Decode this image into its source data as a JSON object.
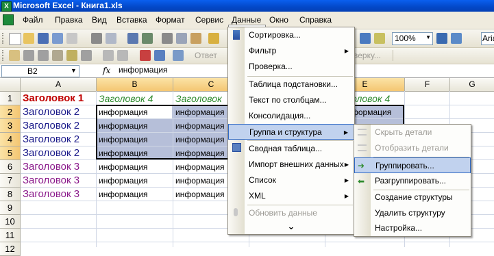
{
  "window": {
    "title": "Microsoft Excel - Книга1.xls"
  },
  "menubar": {
    "items": [
      "Файл",
      "Правка",
      "Вид",
      "Вставка",
      "Формат",
      "Сервис",
      "Данные",
      "Окно",
      "Справка"
    ],
    "active": "Данные"
  },
  "toolbar": {
    "zoom": "100%",
    "font_name_partial": "Aria",
    "reply_partial": "Ответ",
    "review_partial": "верку..."
  },
  "formula": {
    "cell_ref": "B2",
    "fx": "fx",
    "value": "информация"
  },
  "columns": [
    "A",
    "B",
    "C",
    "D",
    "E",
    "F",
    "G"
  ],
  "rows": [
    "1",
    "2",
    "3",
    "4",
    "5",
    "6",
    "7",
    "8",
    "9",
    "10",
    "11",
    "12"
  ],
  "cells": {
    "a1": "Заголовок 1",
    "b1": "Заголовок 4",
    "c1": "Заголовок",
    "e1": "оловок 4",
    "a2": "Заголовок 2",
    "a3": "Заголовок 2",
    "a4": "Заголовок 2",
    "a5": "Заголовок 2",
    "a6": "Заголовок 3",
    "a7": "Заголовок 3",
    "a8": "Заголовок 3",
    "info": "информация",
    "e2": "формация"
  },
  "data_menu": {
    "items": [
      {
        "label": "Сортировка..."
      },
      {
        "label": "Фильтр",
        "submenu": true
      },
      {
        "label": "Проверка..."
      },
      {
        "label": "Таблица подстановки..."
      },
      {
        "label": "Текст по столбцам..."
      },
      {
        "label": "Консолидация..."
      },
      {
        "label": "Группа и структура",
        "submenu": true,
        "highlighted": true
      },
      {
        "label": "Сводная таблица..."
      },
      {
        "label": "Импорт внешних данных",
        "submenu": true
      },
      {
        "label": "Список",
        "submenu": true
      },
      {
        "label": "XML",
        "submenu": true
      },
      {
        "label": "Обновить данные",
        "disabled": true
      }
    ],
    "expand": "⌄"
  },
  "group_submenu": {
    "items": [
      {
        "label": "Скрыть детали",
        "disabled": true
      },
      {
        "label": "Отобразить детали",
        "disabled": true
      },
      {
        "label": "Группировать...",
        "highlighted": true
      },
      {
        "label": "Разгруппировать..."
      },
      {
        "label": "Создание структуры"
      },
      {
        "label": "Удалить структуру"
      },
      {
        "label": "Настройка..."
      }
    ]
  },
  "colors": {
    "selection": "#b6bfd9",
    "highlight": "#c1d2ee",
    "title_bar": "#0a5ff0"
  }
}
